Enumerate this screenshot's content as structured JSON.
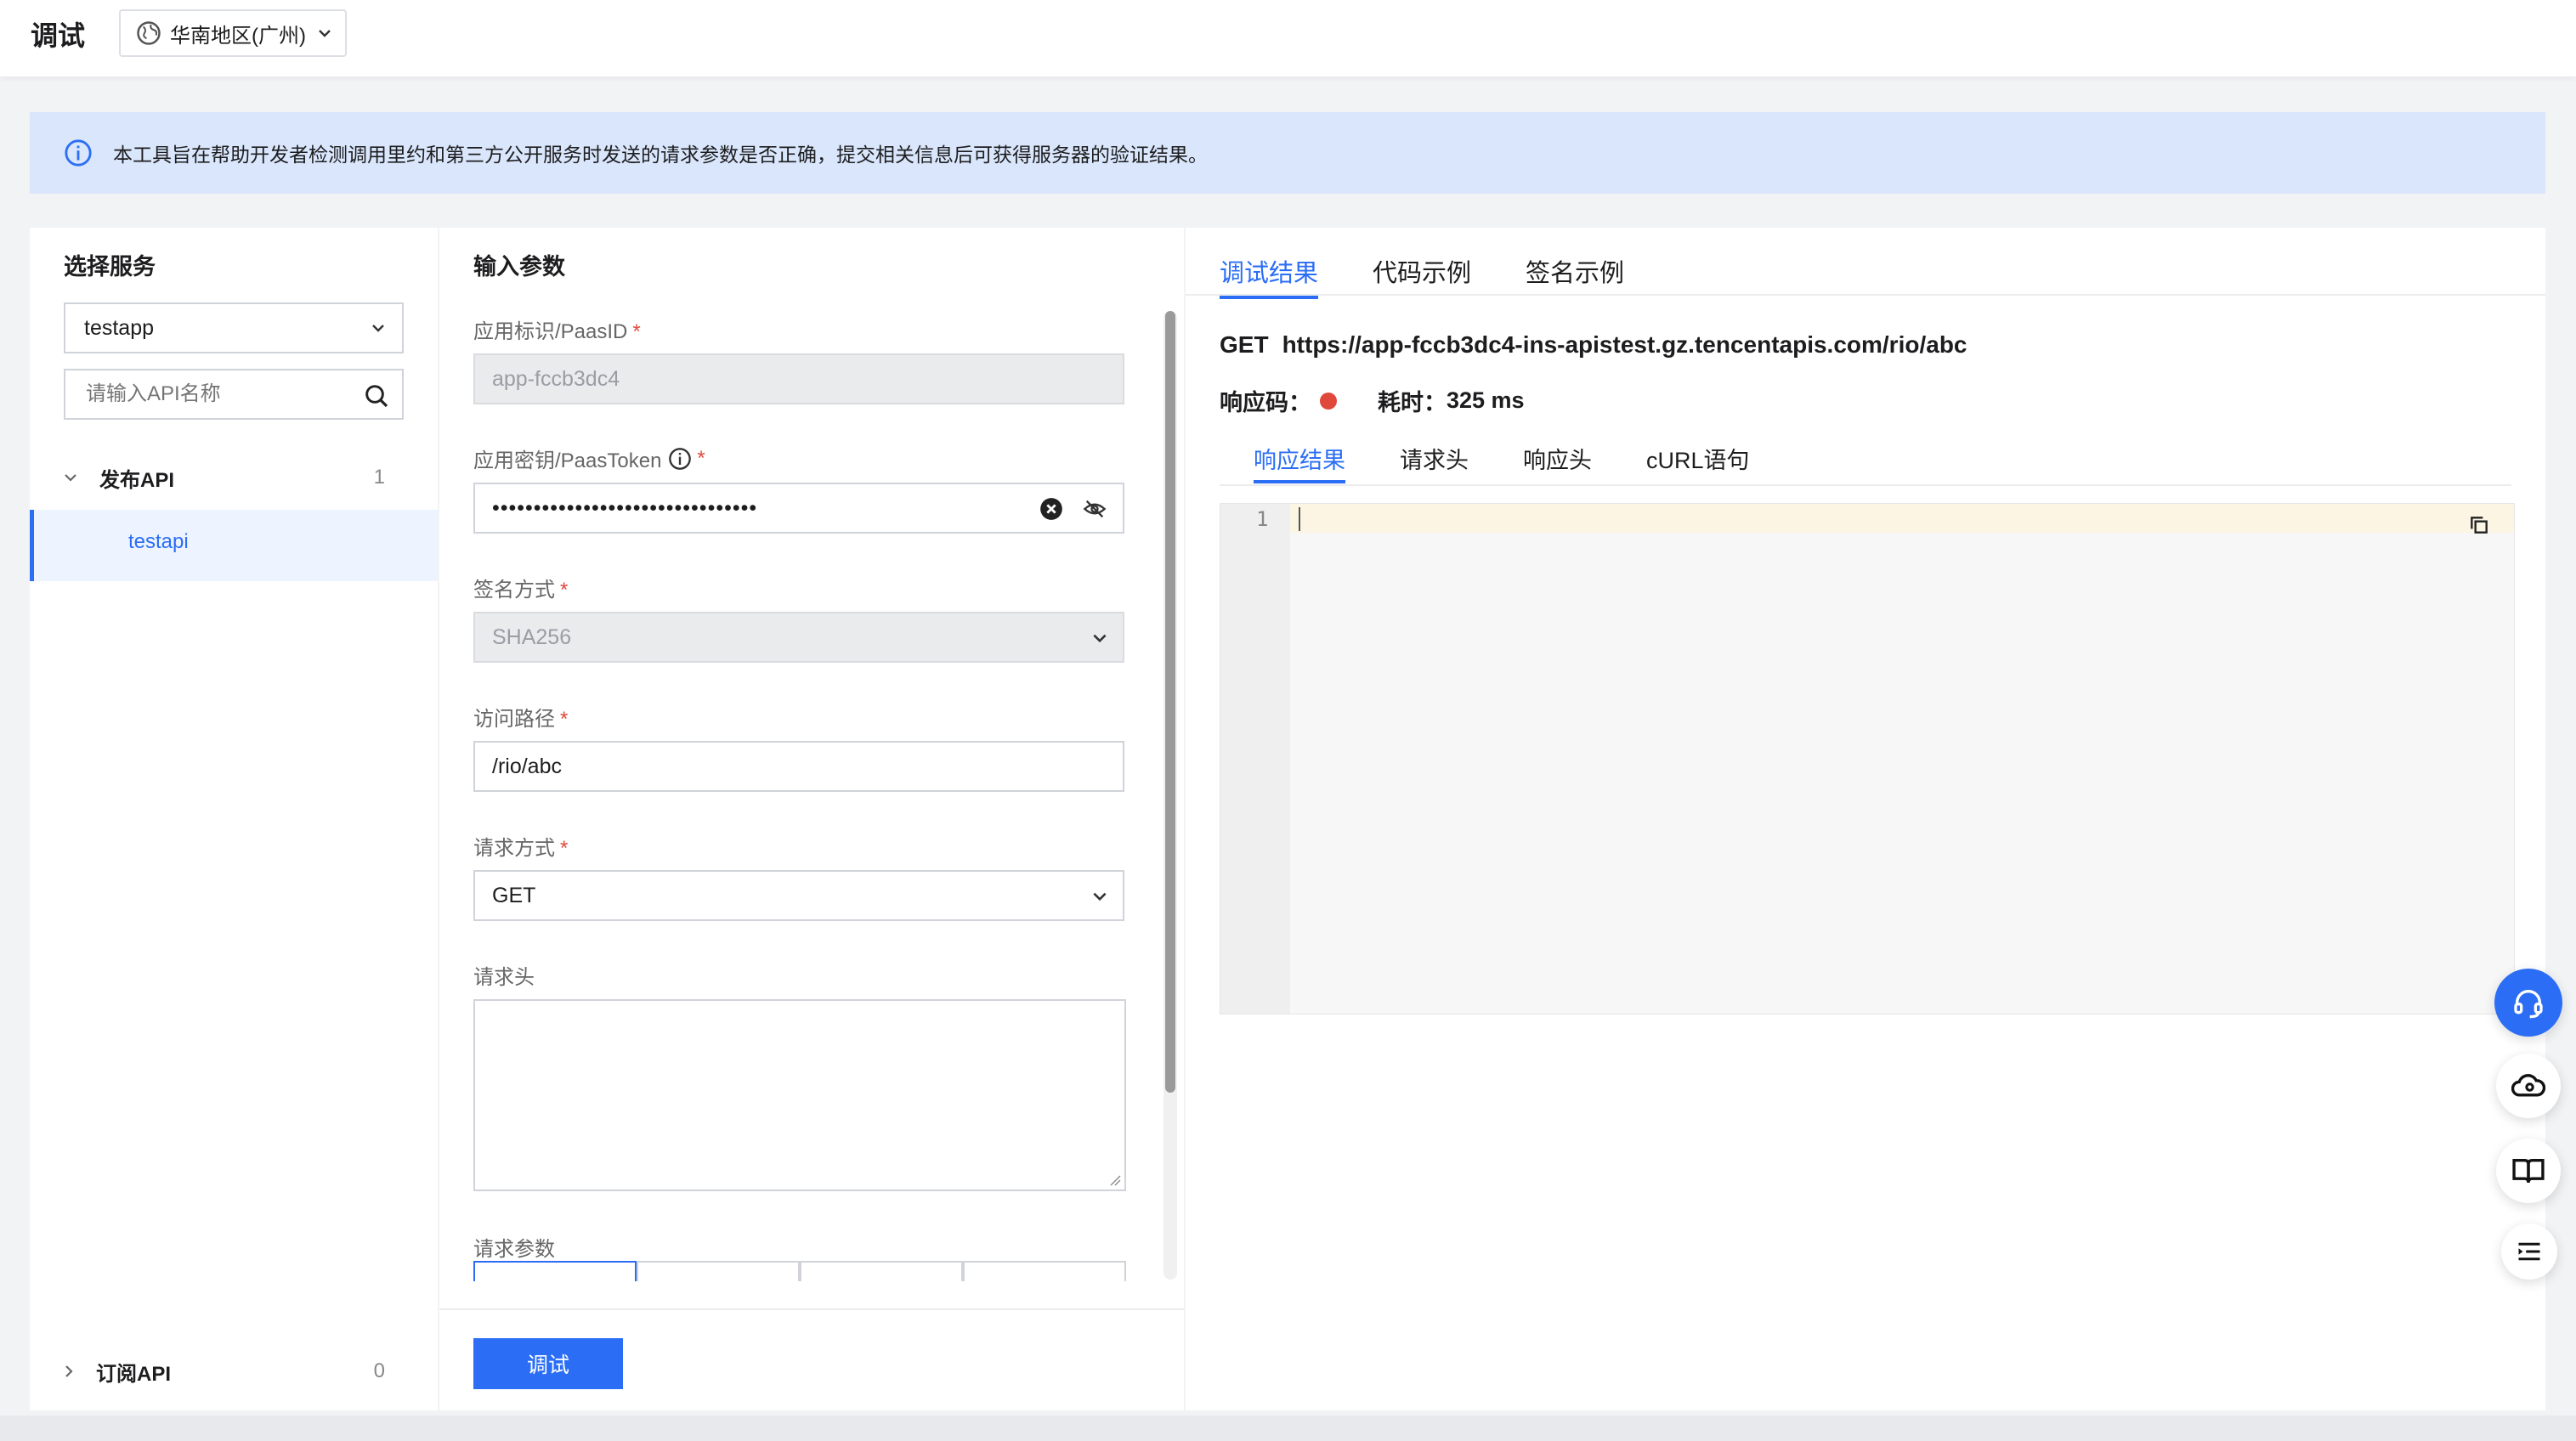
{
  "header": {
    "title": "调试",
    "region": "华南地区(广州)"
  },
  "notice": {
    "text": "本工具旨在帮助开发者检测调用里约和第三方公开服务时发送的请求参数是否正确，提交相关信息后可获得服务器的验证结果。"
  },
  "left_panel": {
    "title": "选择服务",
    "service_selected": "testapp",
    "search_placeholder": "请输入API名称",
    "groups": [
      {
        "label": "发布API",
        "count": "1"
      },
      {
        "label": "订阅API",
        "count": "0"
      }
    ],
    "active_item": "testapi"
  },
  "mid_panel": {
    "title": "输入参数",
    "fields": {
      "paas_id": {
        "label": "应用标识/PaasID",
        "required": "*",
        "value": "app-fccb3dc4"
      },
      "paas_token": {
        "label": "应用密钥/PaasToken",
        "required": "*",
        "value": "••••••••••••••••••••••••••••••••"
      },
      "sign_method": {
        "label": "签名方式",
        "required": "*",
        "value": "SHA256"
      },
      "path": {
        "label": "访问路径",
        "required": "*",
        "value": "/rio/abc"
      },
      "method": {
        "label": "请求方式",
        "required": "*",
        "value": "GET"
      },
      "headers": {
        "label": "请求头"
      },
      "params": {
        "label": "请求参数"
      }
    },
    "submit_label": "调试"
  },
  "right_panel": {
    "tabs": [
      "调试结果",
      "代码示例",
      "签名示例"
    ],
    "request": {
      "method": "GET",
      "url": "https://app-fccb3dc4-ins-apistest.gz.tencentapis.com/rio/abc"
    },
    "status_label": "响应码：",
    "elapsed_label": "耗时：",
    "elapsed_value": "325 ms",
    "status_color": "#e0483b",
    "subtabs": [
      "响应结果",
      "请求头",
      "响应头",
      "cURL语句"
    ],
    "editor": {
      "line_number": "1"
    }
  },
  "floating_buttons": [
    "headset-icon",
    "cloud-icon",
    "book-icon",
    "list-icon"
  ],
  "colors": {
    "accent": "#2b6ef5",
    "notice_bg": "#d9e6fb"
  }
}
